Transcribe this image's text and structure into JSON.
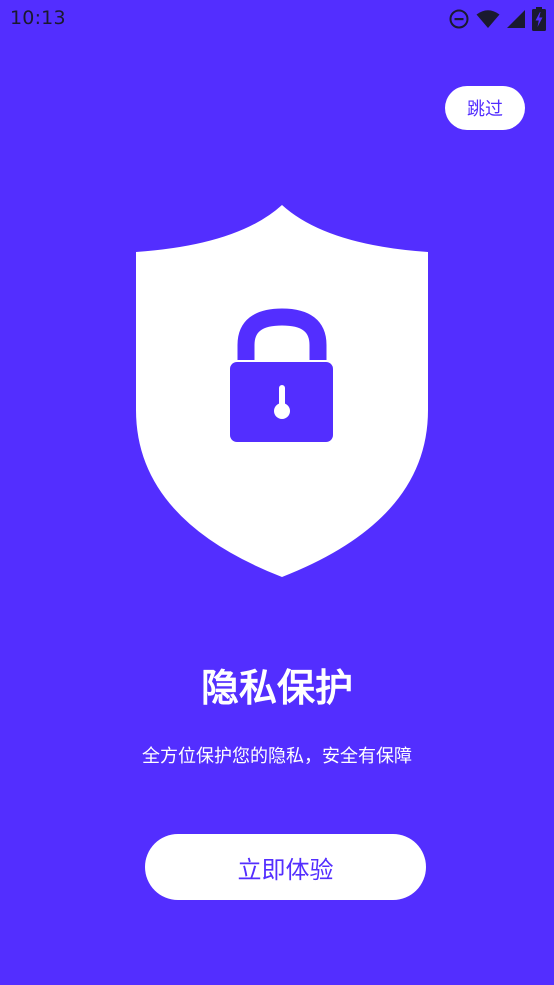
{
  "status_bar": {
    "time": "10:13",
    "icons": [
      "do-not-disturb-icon",
      "wifi-icon",
      "cellular-signal-icon",
      "battery-charging-icon"
    ]
  },
  "onboarding": {
    "skip_label": "跳过",
    "illustration_icon": "shield-lock-icon",
    "title": "隐私保护",
    "subtitle": "全方位保护您的隐私，安全有保障",
    "cta_label": "立即体验"
  },
  "colors": {
    "background": "#532EFF",
    "accent": "#532EFF",
    "surface": "#FFFFFF"
  }
}
